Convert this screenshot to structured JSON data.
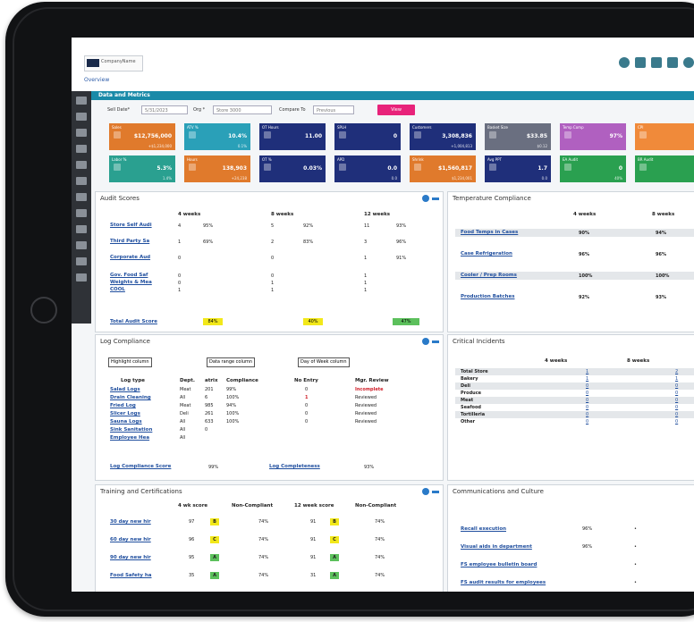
{
  "header": {
    "logo_text": "CompanyName",
    "overview": "Overview"
  },
  "title_bar": "Data and Metrics",
  "filters": {
    "sell_date_label": "Sell Date*",
    "sell_date_value": "5/31/2023",
    "org_label": "Org *",
    "org_value": "Store 3000",
    "compare_label": "Compare To",
    "compare_value": "Previous",
    "view_button": "View"
  },
  "tiles": {
    "row1": [
      {
        "label": "Sales",
        "value": "$12,756,000",
        "sub": "+$1,234,000",
        "color": "#e07a2c"
      },
      {
        "label": "ATV %",
        "value": "10.4%",
        "sub": "0.1%",
        "color": "#2aa0b8"
      },
      {
        "label": "OT Hours",
        "value": "11.00",
        "sub": "",
        "color": "#1f2f7a"
      },
      {
        "label": "SPLH",
        "value": "0",
        "sub": "",
        "color": "#1f2f7a"
      },
      {
        "label": "Customers",
        "value": "3,308,836",
        "sub": "+1,004,813",
        "color": "#1f2f7a"
      },
      {
        "label": "Basket Size",
        "value": "$33.85",
        "sub": "$0.12",
        "color": "#6a6f80"
      },
      {
        "label": "Temp Comp",
        "value": "97%",
        "sub": "",
        "color": "#b060c0"
      },
      {
        "label": "CPI",
        "value": "",
        "sub": "",
        "color": "#f08a3a"
      }
    ],
    "row2": [
      {
        "label": "Labor %",
        "value": "5.3%",
        "sub": "1.4%",
        "color": "#2aa090"
      },
      {
        "label": "Hours",
        "value": "138,903",
        "sub": "+24,238",
        "color": "#e07a2c"
      },
      {
        "label": "OT %",
        "value": "0.03%",
        "sub": "",
        "color": "#1f2f7a"
      },
      {
        "label": "APD",
        "value": "0.0",
        "sub": "0.0",
        "color": "#1f2f7a"
      },
      {
        "label": "Shrink",
        "value": "$1,560,817",
        "sub": "$1,234,001",
        "color": "#e07a2c"
      },
      {
        "label": "Avg PPT",
        "value": "1.7",
        "sub": "0.0",
        "color": "#1f2f7a"
      },
      {
        "label": "EA Audit",
        "value": "0",
        "sub": "40%",
        "color": "#2aa050"
      },
      {
        "label": "BR Audit",
        "value": "",
        "sub": "",
        "color": "#2aa050"
      }
    ]
  },
  "audit": {
    "title": "Audit Scores",
    "headers": [
      "4 weeks",
      "8 weeks",
      "12 weeks"
    ],
    "rows": [
      {
        "name": "Store Self Audi",
        "c": [
          "4",
          "95%",
          "5",
          "92%",
          "11",
          "93%"
        ]
      },
      {
        "name": "Third Party Sa",
        "c": [
          "1",
          "69%",
          "2",
          "83%",
          "3",
          "96%"
        ]
      },
      {
        "name": "Corporate Aud",
        "c": [
          "0",
          "",
          "0",
          "",
          "1",
          "91%"
        ]
      },
      {
        "name": "Gov. Food Saf",
        "c": [
          "0",
          "",
          "0",
          "",
          "1",
          ""
        ]
      },
      {
        "name": "Weights & Mea",
        "c": [
          "0",
          "",
          "1",
          "",
          "1",
          ""
        ]
      },
      {
        "name": "COOL",
        "c": [
          "1",
          "",
          "1",
          "",
          "1",
          ""
        ]
      }
    ],
    "total_label": "Total Audit Score",
    "totals": [
      "84%",
      "40%",
      "47%"
    ]
  },
  "temp": {
    "title": "Temperature Compliance",
    "headers": [
      "4 weeks",
      "8 weeks"
    ],
    "rows": [
      {
        "name": "Food Temps in Cases",
        "c": [
          "90%",
          "94%"
        ]
      },
      {
        "name": "Case Refrigeration",
        "c": [
          "96%",
          "96%"
        ]
      },
      {
        "name": "Cooler / Prep Rooms",
        "c": [
          "100%",
          "100%"
        ]
      },
      {
        "name": "Production Batches",
        "c": [
          "92%",
          "93%"
        ]
      }
    ]
  },
  "log": {
    "title": "Log Compliance",
    "tags": [
      "Highlight column",
      "Data range column",
      "Day of Week column"
    ],
    "headers": [
      "Log type",
      "Dept.",
      "atrix",
      "Compliance",
      "No Entry",
      "Mgr. Review"
    ],
    "rows": [
      {
        "name": "Salad Logs",
        "c": [
          "Meat",
          "201",
          "99%",
          "0",
          "Incomplete"
        ]
      },
      {
        "name": "Drain Cleaning",
        "c": [
          "All",
          "6",
          "100%",
          "1",
          "Reviewed"
        ]
      },
      {
        "name": "Fried Log",
        "c": [
          "Meat",
          "985",
          "94%",
          "0",
          "Reviewed"
        ]
      },
      {
        "name": "Slicer Logs",
        "c": [
          "Deli",
          "261",
          "100%",
          "0",
          "Reviewed"
        ]
      },
      {
        "name": "Sauna Logs",
        "c": [
          "All",
          "633",
          "100%",
          "0",
          "Reviewed"
        ]
      },
      {
        "name": "Sink Sanitation",
        "c": [
          "All",
          "0",
          "",
          "",
          ""
        ]
      },
      {
        "name": "Employee Hea",
        "c": [
          "All",
          "",
          "",
          "",
          ""
        ]
      }
    ],
    "score_label": "Log Compliance Score",
    "score_value": "99%",
    "completeness_label": "Log Completeness",
    "completeness_value": "93%"
  },
  "critical": {
    "title": "Critical Incidents",
    "headers": [
      "4 weeks",
      "8 weeks"
    ],
    "rows": [
      {
        "name": "Total Store",
        "c": [
          "1",
          "2"
        ]
      },
      {
        "name": "Bakery",
        "c": [
          "1",
          "1"
        ]
      },
      {
        "name": "Deli",
        "c": [
          "0",
          "0"
        ]
      },
      {
        "name": "Produce",
        "c": [
          "0",
          "0"
        ]
      },
      {
        "name": "Meat",
        "c": [
          "0",
          "0"
        ]
      },
      {
        "name": "Seafood",
        "c": [
          "0",
          "0"
        ]
      },
      {
        "name": "Tortilleria",
        "c": [
          "0",
          "0"
        ]
      },
      {
        "name": "Other",
        "c": [
          "0",
          "0"
        ]
      }
    ]
  },
  "training": {
    "title": "Training and Certifications",
    "headers": [
      "4 wk score",
      "Non-Compliant",
      "12 week score",
      "Non-Compliant"
    ],
    "rows": [
      {
        "name": "30 day new hir",
        "c": [
          "97",
          "B",
          "74%",
          "91",
          "B",
          "74%"
        ]
      },
      {
        "name": "60 day new hir",
        "c": [
          "96",
          "C",
          "74%",
          "91",
          "C",
          "74%"
        ]
      },
      {
        "name": "90 day new hir",
        "c": [
          "95",
          "A",
          "74%",
          "91",
          "A",
          "74%"
        ]
      },
      {
        "name": "Food Safety ha",
        "c": [
          "35",
          "A",
          "74%",
          "31",
          "A",
          "74%"
        ]
      }
    ]
  },
  "comms": {
    "title": "Communications and Culture",
    "rows": [
      {
        "name": "Recall execution",
        "pct": "96%",
        "dot": "•"
      },
      {
        "name": "Visual aids in department",
        "pct": "96%",
        "dot": "•"
      },
      {
        "name": "FS employee bulletin board",
        "pct": "",
        "dot": "•"
      },
      {
        "name": "FS audit results for employees",
        "pct": "",
        "dot": "•"
      }
    ]
  },
  "colors": {
    "accent": "#1a8aa8",
    "link": "#1f4e9e",
    "highlight_yellow": "#f2e81a",
    "highlight_green": "#5cc05c",
    "view_button": "#e8237a"
  }
}
